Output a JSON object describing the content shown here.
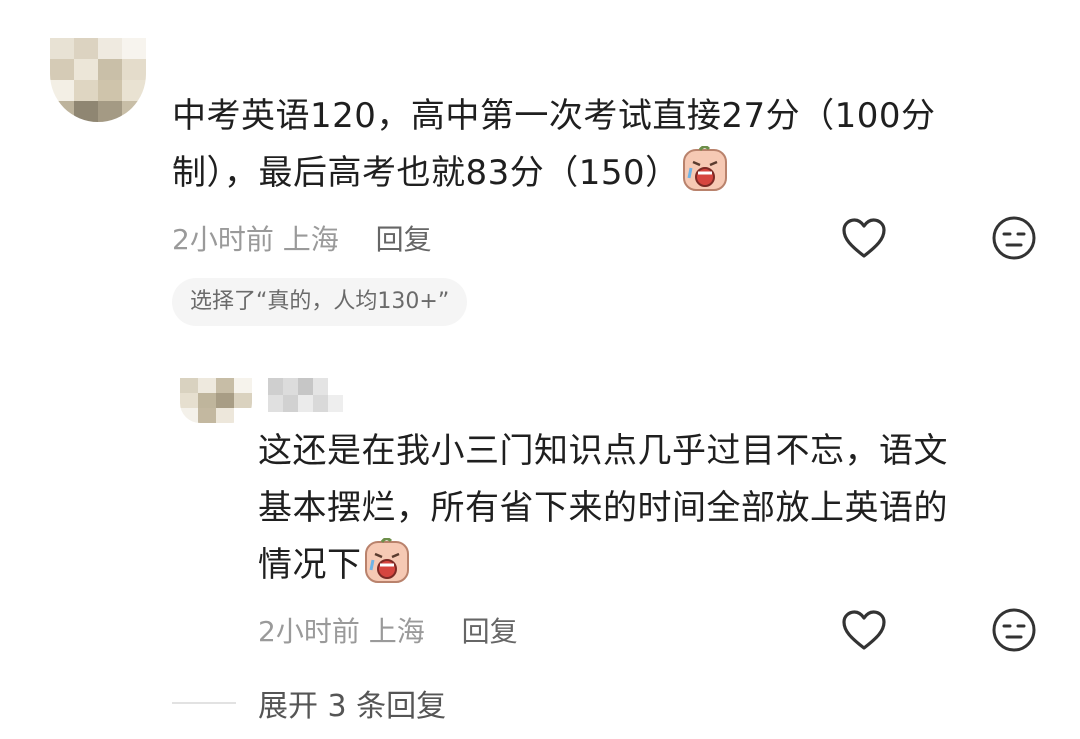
{
  "main_comment": {
    "avatar": "blurred-avatar",
    "text": "中考英语120，高中第一次考试直接27分（100分制），最后高考也就83分（150）",
    "lines": [
      "中考英语120，高中第一次考试直接27分（100分",
      "制），最后高考也就83分（150）"
    ],
    "emoji": "crying-face-emoji",
    "time": "2小时前",
    "location": "上海",
    "reply_label": "回复",
    "poll_choice": "选择了“真的，人均130+”"
  },
  "reply_comment": {
    "avatar": "blurred-avatar",
    "username": "blurred-username",
    "lines": [
      "这还是在我小三门知识点几乎过目不忘，语文",
      "基本摆烂，所有省下来的时间全部放上英语的",
      "情况下"
    ],
    "emoji": "crying-face-emoji",
    "time": "2小时前",
    "location": "上海",
    "reply_label": "回复"
  },
  "expand_replies": "展开 3 条回复",
  "icons": {
    "like": "heart-outline-icon",
    "reaction": "neutral-face-icon"
  },
  "colors": {
    "text": "#1f1f1f",
    "meta": "#9a9a9a",
    "chip_bg": "#f5f5f5"
  }
}
